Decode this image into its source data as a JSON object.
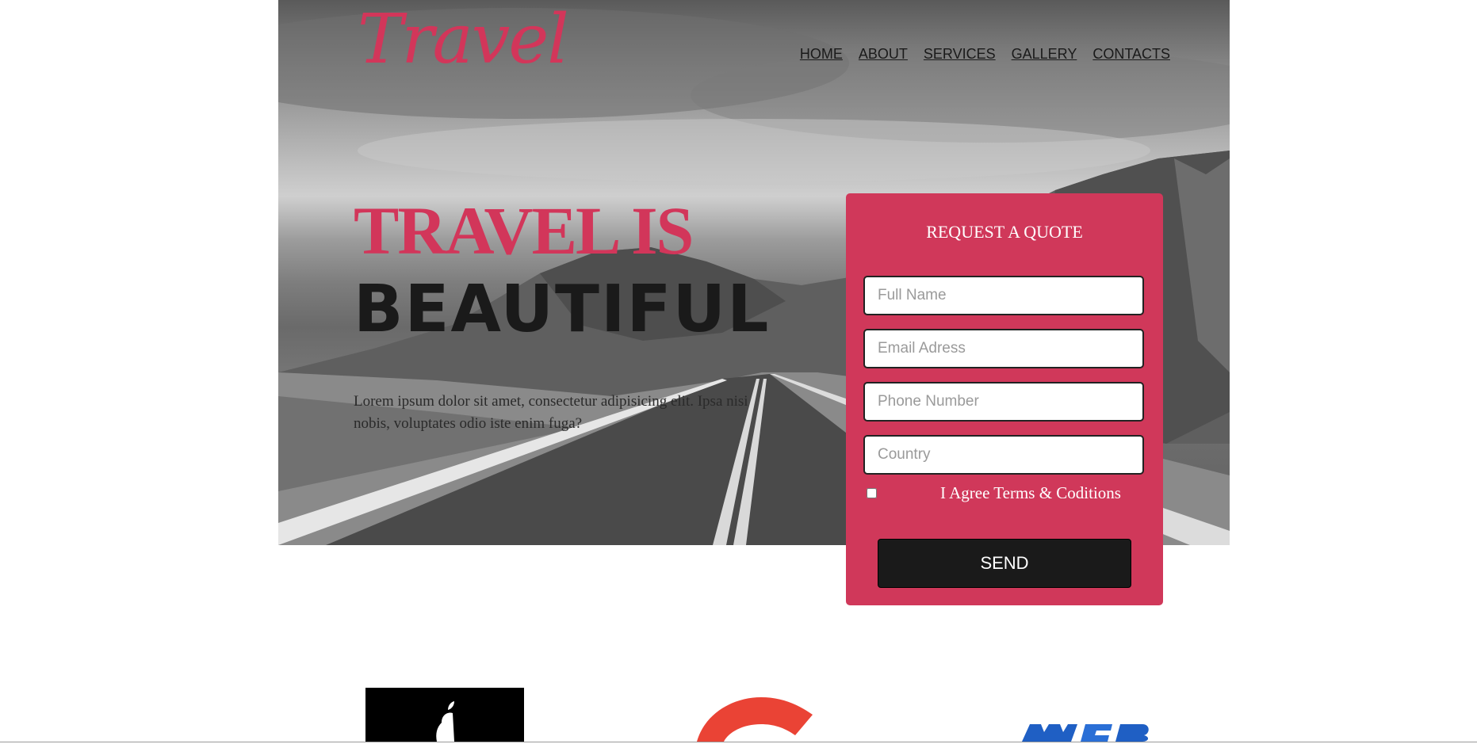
{
  "brand": {
    "logo_text": "Travel",
    "accent": "#d2365a",
    "dark": "#1a1a1a"
  },
  "nav": {
    "items": [
      "HOME",
      "ABOUT",
      "SERVICES",
      "GALLERY",
      "CONTACTS"
    ]
  },
  "hero": {
    "headline_line1": "TRAVEL IS",
    "headline_line2": "BEAUTIFUL",
    "lede": "Lorem ipsum dolor sit amet, consectetur adipisicing elit. Ipsa nisi nobis, voluptates odio iste enim fuga?"
  },
  "quote_form": {
    "title": "REQUEST A QUOTE",
    "full_name_placeholder": "Full Name",
    "email_placeholder": "Email Adress",
    "phone_placeholder": "Phone Number",
    "country_placeholder": "Country",
    "agree_label": "I Agree Terms & Coditions",
    "send_label": "SEND",
    "background": "#d0385a"
  },
  "partners": [
    {
      "name": "apple-logo-icon"
    },
    {
      "name": "google-logo-icon"
    },
    {
      "name": "web-logo-icon"
    }
  ]
}
